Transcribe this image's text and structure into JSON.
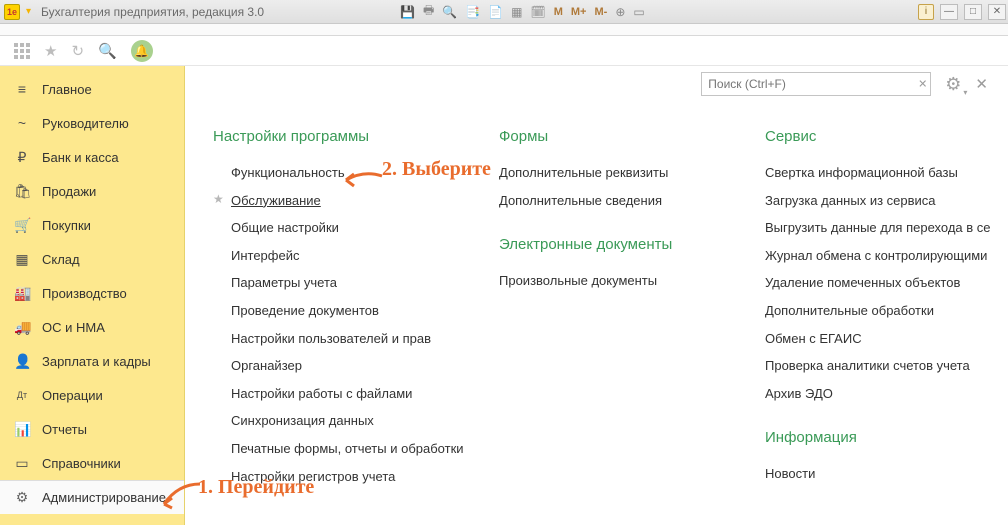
{
  "window": {
    "title": "Бухгалтерия предприятия, редакция 3.0",
    "toolbar_m": "M",
    "toolbar_mplus": "M+",
    "toolbar_mminus": "M-",
    "info_badge": "i"
  },
  "search": {
    "placeholder": "Поиск (Ctrl+F)"
  },
  "sidebar": [
    {
      "icon": "≡",
      "label": "Главное"
    },
    {
      "icon": "~",
      "label": "Руководителю"
    },
    {
      "icon": "₽",
      "label": "Банк и касса"
    },
    {
      "icon": "🛍",
      "label": "Продажи"
    },
    {
      "icon": "🛒",
      "label": "Покупки"
    },
    {
      "icon": "▦",
      "label": "Склад"
    },
    {
      "icon": "🏭",
      "label": "Производство"
    },
    {
      "icon": "🚚",
      "label": "ОС и НМА"
    },
    {
      "icon": "👤",
      "label": "Зарплата и кадры"
    },
    {
      "icon": "Дт",
      "label": "Операции"
    },
    {
      "icon": "📊",
      "label": "Отчеты"
    },
    {
      "icon": "▭",
      "label": "Справочники"
    },
    {
      "icon": "⚙",
      "label": "Администрирование"
    }
  ],
  "sections": {
    "settings": {
      "title": "Настройки программы",
      "items": [
        "Функциональность",
        "Обслуживание",
        "Общие настройки",
        "Интерфейс",
        "Параметры учета",
        "Проведение документов",
        "Настройки пользователей и прав",
        "Органайзер",
        "Настройки работы с файлами",
        "Синхронизация данных",
        "Печатные формы, отчеты и обработки",
        "Настройки регистров учета"
      ]
    },
    "forms": {
      "title": "Формы",
      "items": [
        "Дополнительные реквизиты",
        "Дополнительные сведения"
      ]
    },
    "edocs": {
      "title": "Электронные документы",
      "items": [
        "Произвольные документы"
      ]
    },
    "service": {
      "title": "Сервис",
      "items": [
        "Свертка информационной базы",
        "Загрузка данных из сервиса",
        "Выгрузить данные для перехода в се",
        "Журнал обмена с контролирующими",
        "Удаление помеченных объектов",
        "Дополнительные обработки",
        "Обмен с ЕГАИС",
        "Проверка аналитики счетов учета",
        "Архив ЭДО"
      ]
    },
    "info": {
      "title": "Информация",
      "items": [
        "Новости"
      ]
    }
  },
  "annotations": {
    "step1": "1. Перейдите",
    "step2": "2. Выберите"
  }
}
